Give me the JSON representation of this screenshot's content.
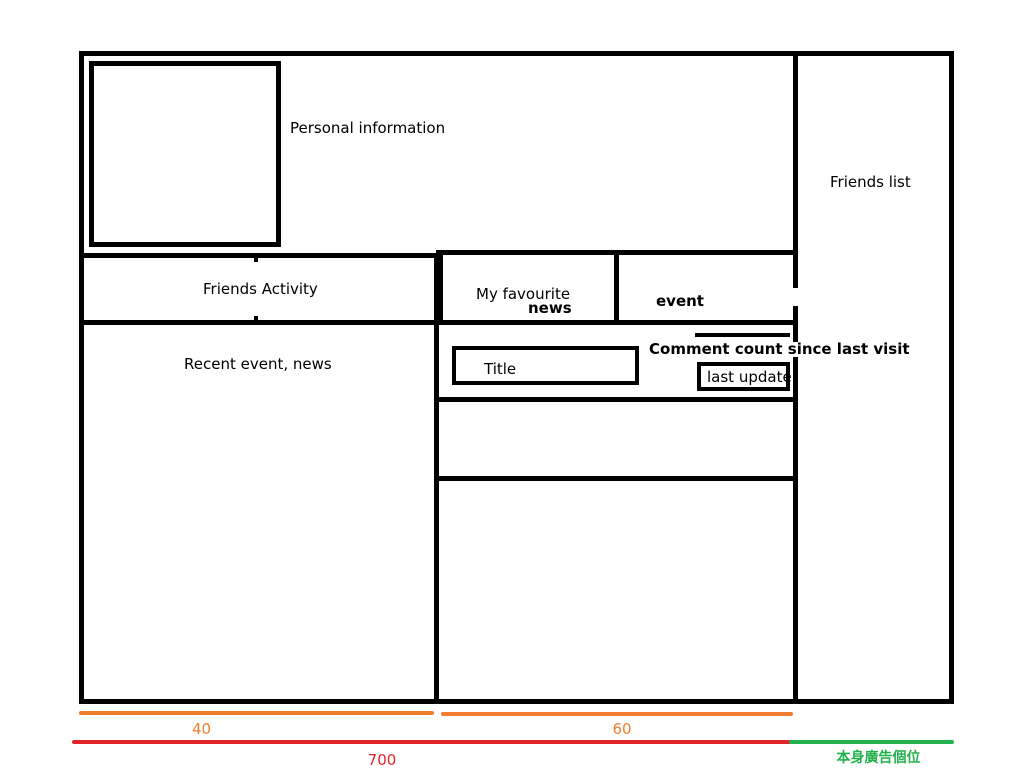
{
  "wireframe": {
    "personal_info_label": "Personal information",
    "friends_list_label": "Friends list",
    "friends_activity_label": "Friends Activity",
    "recent_event_news_label": "Recent event, news",
    "my_favourite_label": "My favourite",
    "news_label": "news",
    "event_label": "event",
    "title_label": "Title",
    "comment_count_label": "Comment count since last visit",
    "last_update_label": "last update"
  },
  "dimensions": {
    "left_width_label": "40",
    "middle_width_label": "60",
    "main_width_label": "700",
    "ad_slot_label": "本身廣告個位"
  },
  "colors": {
    "orange": "#ef7d2d",
    "red": "#e3242b",
    "green": "#22b14c",
    "line": "#000000"
  }
}
